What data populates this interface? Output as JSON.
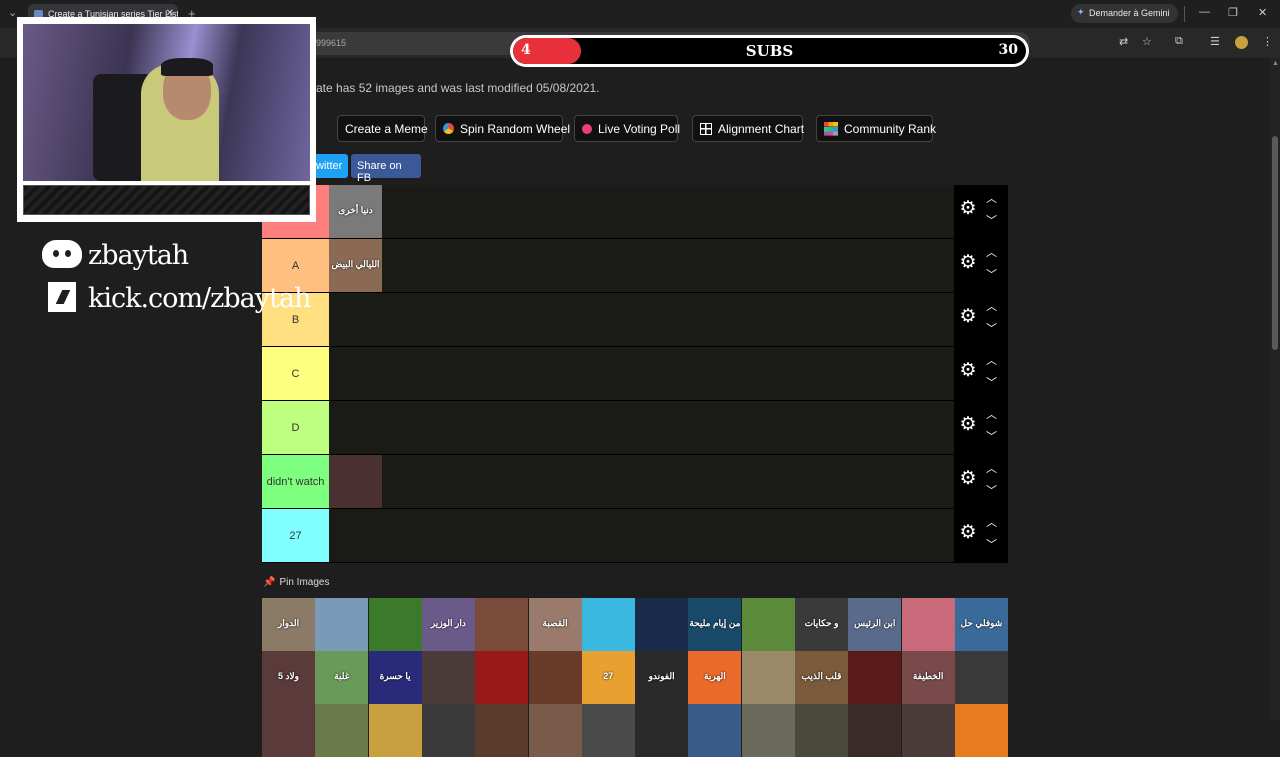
{
  "browser": {
    "tab_title": "Create a Tunisian series Tier List",
    "close_glyph": "✕",
    "new_tab_glyph": "+",
    "tablist_glyph": "⌄",
    "gemini_label": "Demander à Gemini",
    "url_fragment": "999615",
    "minimize_glyph": "—",
    "restore_glyph": "❐",
    "close_window_glyph": "✕",
    "icons": [
      "translate-icon",
      "star-icon",
      "extensions-icon",
      "reading-list-icon",
      "profile-icon",
      "menu-icon"
    ]
  },
  "page": {
    "info_text": "ate has 52 images and was last modified 05/08/2021.",
    "buttons": {
      "create_meme": "Create a Meme",
      "spin_wheel": "Spin Random Wheel",
      "voting_poll": "Live Voting Poll",
      "alignment_chart": "Alignment Chart",
      "community_rank": "Community Rank"
    },
    "share": {
      "twitter": "witter",
      "fb": "Share on FB"
    },
    "tiers": [
      {
        "label": "",
        "color": "#ff7f7f",
        "item_colors": [
          "#7a7a7a"
        ],
        "item_texts": [
          "دنيا أخرى"
        ]
      },
      {
        "label": "A",
        "color": "#ffbf7f",
        "item_colors": [
          "#8a6a55"
        ],
        "item_texts": [
          "الليالي البيض"
        ]
      },
      {
        "label": "B",
        "color": "#ffdf7f",
        "item_colors": [],
        "item_texts": []
      },
      {
        "label": "C",
        "color": "#ffff7f",
        "item_colors": [],
        "item_texts": []
      },
      {
        "label": "D",
        "color": "#bfff7f",
        "item_colors": [],
        "item_texts": []
      },
      {
        "label": "didn't watch",
        "color": "#7fff7f",
        "item_colors": [
          "#4a3030"
        ],
        "item_texts": [
          ""
        ]
      },
      {
        "label": "27",
        "color": "#7fffff",
        "item_colors": [],
        "item_texts": []
      }
    ],
    "pin_label": "Pin Images",
    "pool_row1": [
      {
        "color": "#8a7a66",
        "text": "الدوار"
      },
      {
        "color": "#7a9ab8",
        "text": ""
      },
      {
        "color": "#3a7a2a",
        "text": ""
      },
      {
        "color": "#6a5a8a",
        "text": "دار الوزير"
      },
      {
        "color": "#7a4a3a",
        "text": ""
      },
      {
        "color": "#9a7a6a",
        "text": "القصبة"
      },
      {
        "color": "#3ab8e0",
        "text": ""
      },
      {
        "color": "#1a2a4a",
        "text": ""
      },
      {
        "color": "#1a4a6a",
        "text": "من إيام مليحة"
      },
      {
        "color": "#5a8a3a",
        "text": ""
      },
      {
        "color": "#3a3a3a",
        "text": "و حكايات"
      },
      {
        "color": "#5a6a8a",
        "text": "ابن الرئيس"
      },
      {
        "color": "#c86a7a",
        "text": ""
      },
      {
        "color": "#3a6a9a",
        "text": "شوفلي حل"
      }
    ],
    "pool_row2": [
      {
        "color": "#5a3a3a",
        "text": "5 ولاد"
      },
      {
        "color": "#6a9a5a",
        "text": "غلبة"
      },
      {
        "color": "#2a2a7a",
        "text": "يا حسرة"
      },
      {
        "color": "#4a3a3a",
        "text": ""
      },
      {
        "color": "#9a1a1a",
        "text": ""
      },
      {
        "color": "#6a3a2a",
        "text": ""
      },
      {
        "color": "#e8a030",
        "text": "27"
      },
      {
        "color": "#2a2a2a",
        "text": "الفوندو"
      },
      {
        "color": "#ea6a2a",
        "text": "الهربة"
      },
      {
        "color": "#9a8a6a",
        "text": ""
      },
      {
        "color": "#7a5a3a",
        "text": "قلب الذيب"
      },
      {
        "color": "#5a1a1a",
        "text": ""
      },
      {
        "color": "#7a4a4a",
        "text": "الخطيفة"
      },
      {
        "color": "#3a3a3a",
        "text": ""
      }
    ],
    "pool_row3": [
      {
        "color": "#5a3a3a"
      },
      {
        "color": "#6a7a4a"
      },
      {
        "color": "#c8a040"
      },
      {
        "color": "#3a3a3a"
      },
      {
        "color": "#5a3a2a"
      },
      {
        "color": "#7a5a4a"
      },
      {
        "color": "#4a4a4a"
      },
      {
        "color": "#2a2a2a"
      },
      {
        "color": "#3a5a8a"
      },
      {
        "color": "#6a6a5a"
      },
      {
        "color": "#4a4a3a"
      },
      {
        "color": "#3a2a2a"
      },
      {
        "color": "#4a3a3a"
      },
      {
        "color": "#e87a20"
      }
    ]
  },
  "overlay": {
    "discord_handle": "zbaytah",
    "kick_url": "kick.com/zbaytah",
    "subs": {
      "current": "4",
      "label": "SUBS",
      "goal": "30",
      "progress_fraction": 0.133
    }
  }
}
